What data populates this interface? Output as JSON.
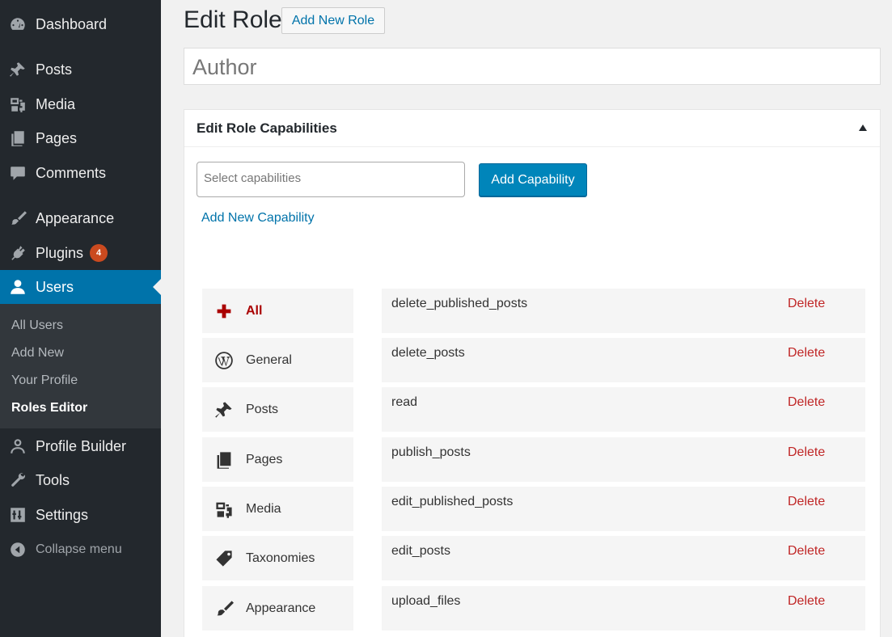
{
  "sidebar": {
    "items": [
      {
        "label": "Dashboard",
        "icon": "dashboard-icon"
      },
      {
        "label": "Posts",
        "icon": "pin-icon"
      },
      {
        "label": "Media",
        "icon": "media-icon"
      },
      {
        "label": "Pages",
        "icon": "pages-icon"
      },
      {
        "label": "Comments",
        "icon": "comment-icon"
      },
      {
        "label": "Appearance",
        "icon": "brush-icon"
      },
      {
        "label": "Plugins",
        "icon": "plugin-icon",
        "badge": "4"
      },
      {
        "label": "Users",
        "icon": "user-icon"
      },
      {
        "label": "Profile Builder",
        "icon": "user-outline-icon"
      },
      {
        "label": "Tools",
        "icon": "wrench-icon"
      },
      {
        "label": "Settings",
        "icon": "settings-icon"
      },
      {
        "label": "Collapse menu",
        "icon": "collapse-icon"
      }
    ],
    "submenu": [
      "All Users",
      "Add New",
      "Your Profile",
      "Roles Editor"
    ]
  },
  "header": {
    "title": "Edit Role",
    "add_new_label": "Add New Role"
  },
  "role": {
    "name": "Author"
  },
  "capabilities_box": {
    "title": "Edit Role Capabilities",
    "select_placeholder": "Select capabilities",
    "add_button": "Add Capability",
    "add_new_link": "Add New Capability",
    "tabs": [
      {
        "label": "All",
        "icon": "plus-icon"
      },
      {
        "label": "General",
        "icon": "wordpress-icon"
      },
      {
        "label": "Posts",
        "icon": "pin-icon"
      },
      {
        "label": "Pages",
        "icon": "pages-icon"
      },
      {
        "label": "Media",
        "icon": "media-icon"
      },
      {
        "label": "Taxonomies",
        "icon": "tag-icon"
      },
      {
        "label": "Appearance",
        "icon": "brush-icon"
      }
    ],
    "capabilities": [
      {
        "name": "delete_published_posts",
        "action": "Delete"
      },
      {
        "name": "delete_posts",
        "action": "Delete"
      },
      {
        "name": "read",
        "action": "Delete"
      },
      {
        "name": "publish_posts",
        "action": "Delete"
      },
      {
        "name": "edit_published_posts",
        "action": "Delete"
      },
      {
        "name": "edit_posts",
        "action": "Delete"
      },
      {
        "name": "upload_files",
        "action": "Delete"
      }
    ]
  },
  "colors": {
    "sidebar_bg": "#23282d",
    "accent": "#0073aa",
    "delete": "#c02626",
    "badge": "#ca4a1f"
  }
}
